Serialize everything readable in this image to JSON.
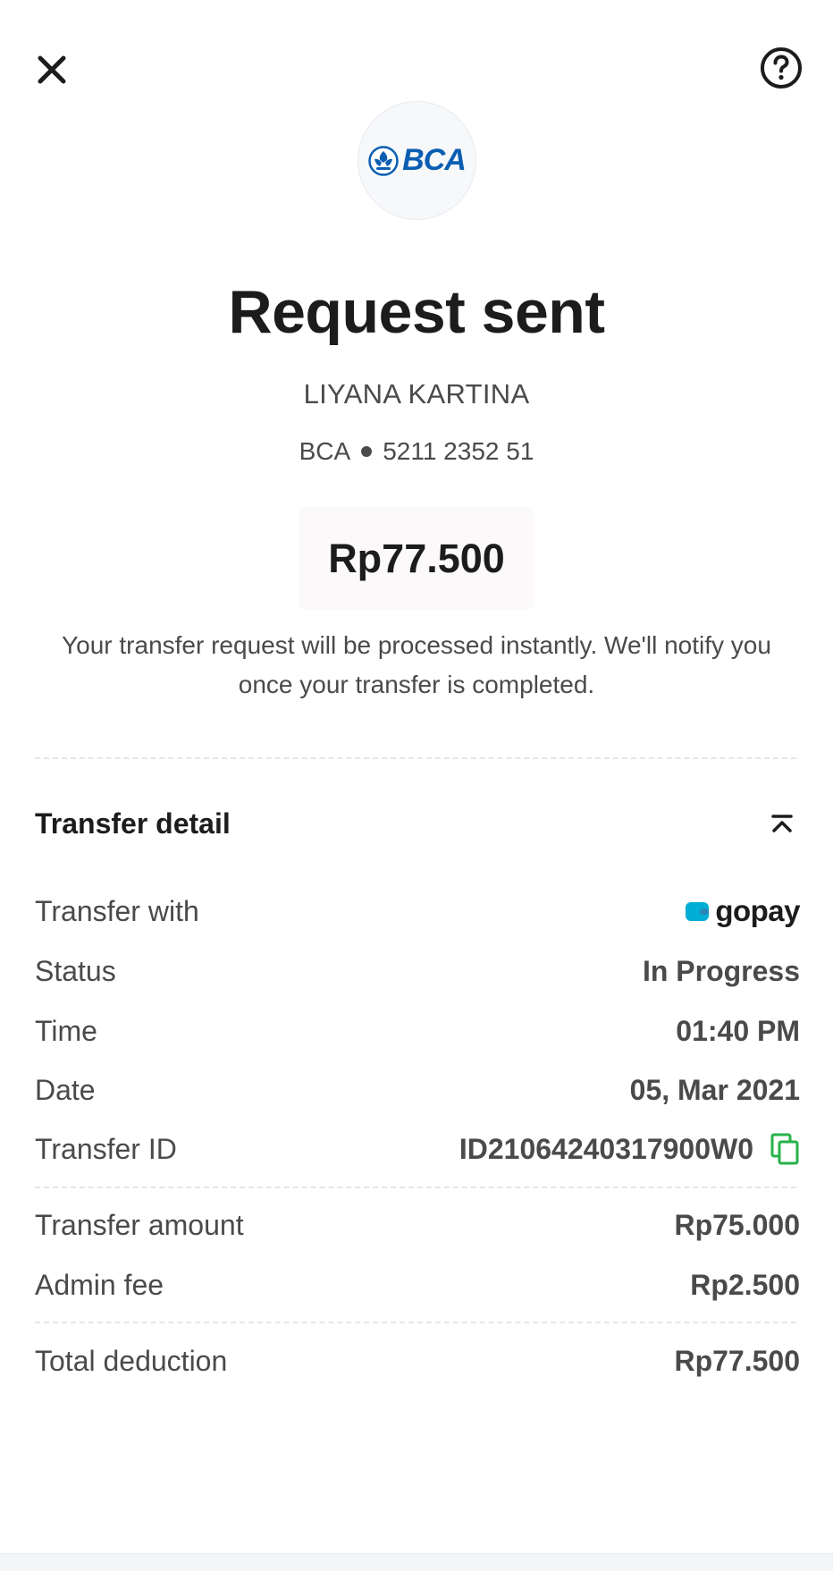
{
  "header": {
    "close_icon": "close-icon",
    "help_icon": "help-icon"
  },
  "bank_logo": {
    "text": "BCA",
    "color": "#0a5eb2"
  },
  "title": "Request sent",
  "recipient": {
    "name": "LIYANA KARTINA",
    "bank": "BCA",
    "account_number": "5211 2352 51"
  },
  "amount": "Rp77.500",
  "note": "Your transfer request will be processed instantly. We'll notify you once your transfer is completed.",
  "transfer_detail": {
    "title": "Transfer detail",
    "collapse_icon": "collapse-up-icon",
    "rows": [
      {
        "label": "Transfer with",
        "value": "gopay"
      },
      {
        "label": "Status",
        "value": "In Progress"
      },
      {
        "label": "Time",
        "value": "01:40 PM"
      },
      {
        "label": "Date",
        "value": "05, Mar 2021"
      },
      {
        "label": "Transfer ID",
        "value": "ID21064240317900W0"
      }
    ],
    "copy_icon": "copy-icon",
    "copy_color": "#27b24a",
    "gopay_color": "#00aed6",
    "costs": [
      {
        "label": "Transfer amount",
        "value": "Rp75.000"
      },
      {
        "label": "Admin fee",
        "value": "Rp2.500"
      }
    ],
    "total": {
      "label": "Total deduction",
      "value": "Rp77.500"
    }
  }
}
